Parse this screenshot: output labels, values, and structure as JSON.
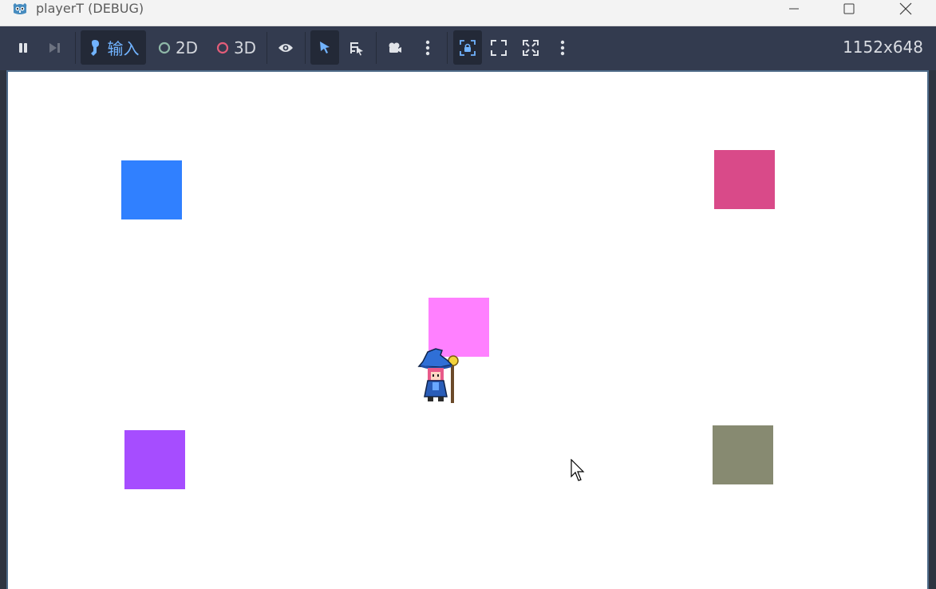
{
  "window": {
    "title": "playerT (DEBUG)",
    "icon": "godot-icon"
  },
  "toolbar": {
    "input_label": "输入",
    "mode_2d_label": "2D",
    "mode_3d_label": "3D",
    "resolution": "1152x648",
    "accent_color": "#71b3ff",
    "color_2d_icon": "#8fb8a8",
    "color_3d_icon": "#e35d79"
  },
  "game": {
    "background": "#ffffff",
    "squares": [
      {
        "name": "blue-square",
        "color": "#3080ff"
      },
      {
        "name": "pink-square",
        "color": "#d94a89"
      },
      {
        "name": "magenta-square",
        "color": "#ff80ff"
      },
      {
        "name": "purple-square",
        "color": "#a64dff"
      },
      {
        "name": "olive-square",
        "color": "#878a71"
      }
    ],
    "player": "wizard-sprite"
  }
}
